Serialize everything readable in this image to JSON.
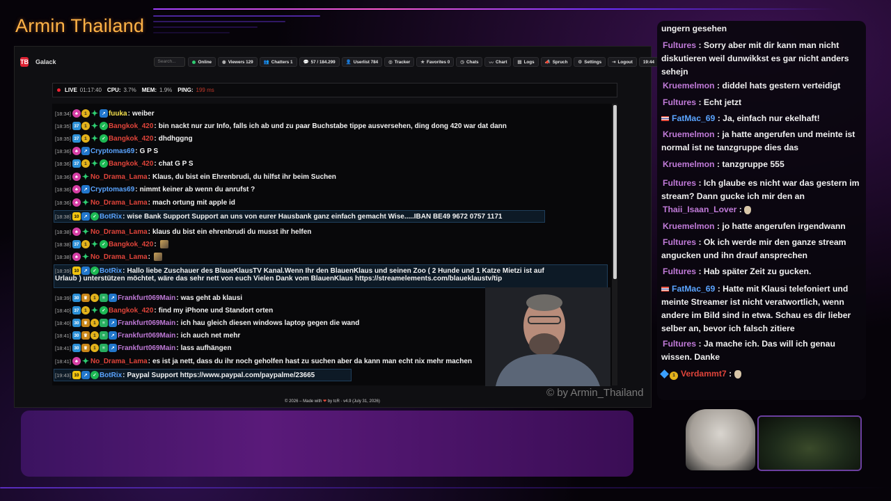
{
  "stream": {
    "title": "Armin Thailand",
    "watermark": "© by Armin_Thailand"
  },
  "app": {
    "logo": "TB",
    "name": "Galack",
    "search_placeholder": "Search...",
    "toolbar": [
      {
        "icon": "online-dot",
        "label": "Online"
      },
      {
        "icon": "eye-icon",
        "label": "Viewers 129"
      },
      {
        "icon": "users-icon",
        "label": "Chatters 1"
      },
      {
        "icon": "message-icon",
        "label": "57 / 184.299"
      },
      {
        "icon": "user-icon",
        "label": "Userlist 784"
      },
      {
        "icon": "tracker-icon",
        "label": "Tracker"
      },
      {
        "icon": "star-icon",
        "label": "Favorites 0"
      },
      {
        "icon": "clock-icon",
        "label": "Chats"
      },
      {
        "icon": "chart-icon",
        "label": "Chart"
      },
      {
        "icon": "logs-icon",
        "label": "Logs"
      },
      {
        "icon": "bullhorn-icon",
        "label": "Spruch"
      },
      {
        "icon": "gear-icon",
        "label": "Settings"
      },
      {
        "icon": "logout-icon",
        "label": "Logout"
      },
      {
        "icon": "",
        "label": "19:44"
      }
    ],
    "status": {
      "live_label": "LIVE",
      "live_time": "01:17:40",
      "cpu_label": "CPU:",
      "cpu_value": "3.7%",
      "mem_label": "MEM:",
      "mem_value": "1.9%",
      "ping_label": "PING:",
      "ping_value": "199 ms"
    },
    "messages": [
      {
        "time": "[18:34]",
        "badges": [
          "pink",
          "gold",
          "green",
          "blue"
        ],
        "user": "fuuka",
        "color": "#f4e04d",
        "text": "weiber"
      },
      {
        "time": "[18:35]",
        "badges": [
          "num:37",
          "gold",
          "green",
          "check"
        ],
        "user": "Bangkok_420",
        "color": "#e0443a",
        "text": "bin nackt nur zur Info, falls ich ab und zu paar Buchstabe tippe ausversehen, ding dong 420 war dat dann"
      },
      {
        "time": "[18:35]",
        "badges": [
          "num:37",
          "gold",
          "green",
          "check"
        ],
        "user": "Bangkok_420",
        "color": "#e0443a",
        "text": "dhdhggng"
      },
      {
        "time": "[18:36]",
        "badges": [
          "pink",
          "blue"
        ],
        "user": "Cryptomas69",
        "color": "#5aa4ff",
        "text": "G P S"
      },
      {
        "time": "[18:36]",
        "badges": [
          "num:37",
          "gold",
          "green",
          "check"
        ],
        "user": "Bangkok_420",
        "color": "#e0443a",
        "text": "chat G P S"
      },
      {
        "time": "[18:36]",
        "badges": [
          "pink",
          "green"
        ],
        "user": "No_Drama_Lama",
        "color": "#e0443a",
        "text": "Klaus, du bist ein Ehrenbrudi, du hilfst ihr beim Suchen"
      },
      {
        "time": "[18:36]",
        "badges": [
          "pink",
          "blue"
        ],
        "user": "Cryptomas69",
        "color": "#5aa4ff",
        "text": "nimmt keiner ab wenn du anrufst ?"
      },
      {
        "time": "[18:36]",
        "badges": [
          "pink",
          "green"
        ],
        "user": "No_Drama_Lama",
        "color": "#e0443a",
        "text": "mach ortung mit apple id"
      },
      {
        "time": "[18:38]",
        "badges": [
          "yellow:10",
          "blue",
          "check"
        ],
        "user": "BotRix",
        "color": "#5aa4ff",
        "text": "wise Bank Support Support an uns von eurer Hausbank ganz einfach gemacht Wise.....IBAN BE49 9672 0757 1171"
      },
      {
        "time": "[18:38]",
        "badges": [
          "pink",
          "green"
        ],
        "user": "No_Drama_Lama",
        "color": "#e0443a",
        "text": "klaus du bist ein ehrenbrudi du musst ihr helfen"
      },
      {
        "time": "[18:38]",
        "badges": [
          "num:37",
          "gold",
          "green",
          "check"
        ],
        "user": "Bangkok_420",
        "color": "#e0443a",
        "text": ""
      },
      {
        "time": "[18:38]",
        "badges": [
          "pink",
          "green"
        ],
        "user": "No_Drama_Lama",
        "color": "#e0443a",
        "text": ""
      },
      {
        "time": "[18:39]",
        "badges": [
          "yellow:10",
          "blue",
          "check"
        ],
        "user": "BotRix",
        "color": "#5aa4ff",
        "text": "Hallo liebe Zuschauer des BlaueKlausTV Kanal.Wenn Ihr den BlauenKlaus und seinen Zoo ( 2 Hunde und 1 Katze Mietzi ist auf",
        "text2": "Urlaub ) unterstützen möchtet, wäre das sehr nett von euch Vielen Dank vom BlauenKlaus https://streamelements.com/blaueklaustv/tip"
      },
      {
        "time": "[18:39]",
        "badges": [
          "num:30",
          "crown",
          "gold",
          "grn2",
          "blue"
        ],
        "user": "Frankfurt069Main",
        "color": "#c07ad8",
        "text": "was geht ab klausi"
      },
      {
        "time": "[18:40]",
        "badges": [
          "num:37",
          "gold",
          "green",
          "check"
        ],
        "user": "Bangkok_420",
        "color": "#e0443a",
        "text": "find my iPhone und Standort orten"
      },
      {
        "time": "[18:40]",
        "badges": [
          "num:30",
          "crown",
          "gold",
          "grn2",
          "blue"
        ],
        "user": "Frankfurt069Main",
        "color": "#c07ad8",
        "text": "ich hau gleich diesen windows laptop gegen die wand"
      },
      {
        "time": "[18:41]",
        "badges": [
          "num:30",
          "crown",
          "gold",
          "grn2",
          "blue"
        ],
        "user": "Frankfurt069Main",
        "color": "#c07ad8",
        "text": "ich auch net mehr"
      },
      {
        "time": "[18:41]",
        "badges": [
          "num:30",
          "crown",
          "gold",
          "grn2",
          "blue"
        ],
        "user": "Frankfurt069Main",
        "color": "#c07ad8",
        "text": "lass aufhängen"
      },
      {
        "time": "[18:41]",
        "badges": [
          "pink",
          "green"
        ],
        "user": "No_Drama_Lama",
        "color": "#e0443a",
        "text": "es ist ja nett, dass du ihr noch geholfen hast zu suchen aber da kann man echt nix mehr machen"
      },
      {
        "time": "[19:43]",
        "badges": [
          "yellow:10",
          "blue",
          "check"
        ],
        "user": "BotRix",
        "color": "#5aa4ff",
        "text": "Paypal Support https://www.paypal.com/paypalme/23665"
      }
    ],
    "footer": {
      "prefix": "© 2026 – Made with",
      "suffix": "by tcR · v4.9 (July 31, 2026)"
    }
  },
  "side_chat": [
    {
      "user": "",
      "text": "ungern gesehen"
    },
    {
      "user": "Fultures",
      "text": "Sorry aber mit dir kann man nicht diskutieren weil dunwikkst es gar nicht anders sehejn"
    },
    {
      "user": "Kruemelmon",
      "text": "diddel hats gestern verteidigt"
    },
    {
      "user": "Fultures",
      "text": "Echt jetzt"
    },
    {
      "user": "FatMac_69",
      "flag": true,
      "text": "Ja, einfach nur ekelhaft!"
    },
    {
      "user": "Kruemelmon",
      "text": "ja hatte angerufen und meinte ist normal ist ne tanzgruppe dies das"
    },
    {
      "user": "Kruemelmon",
      "text": "tanzgruppe 555"
    },
    {
      "user": "Fultures",
      "text": "Ich glaube es nicht war das gestern im stream? Dann gucke ich mir den an"
    },
    {
      "user": "Thaii_Isaan_Lover",
      "text": ""
    },
    {
      "user": "Kruemelmon",
      "text": "jo hatte angerufen irgendwann"
    },
    {
      "user": "Fultures",
      "text": "Ok ich werde mir den ganze stream angucken und ihn drauf ansprechen"
    },
    {
      "user": "Fultures",
      "text": "Hab später Zeit zu gucken."
    },
    {
      "user": "FatMac_69",
      "flag": true,
      "text": "Hatte mit Klausi telefoniert und meinte Streamer ist nicht veratwortlich, wenn andere im Bild sind in etwa. Schau es dir lieber selber an, bevor ich falsch zitiere"
    },
    {
      "user": "Fultures",
      "text": "Ja mache ich. Das will ich genau wissen. Danke"
    },
    {
      "user": "Verdammt7",
      "text": ""
    }
  ]
}
